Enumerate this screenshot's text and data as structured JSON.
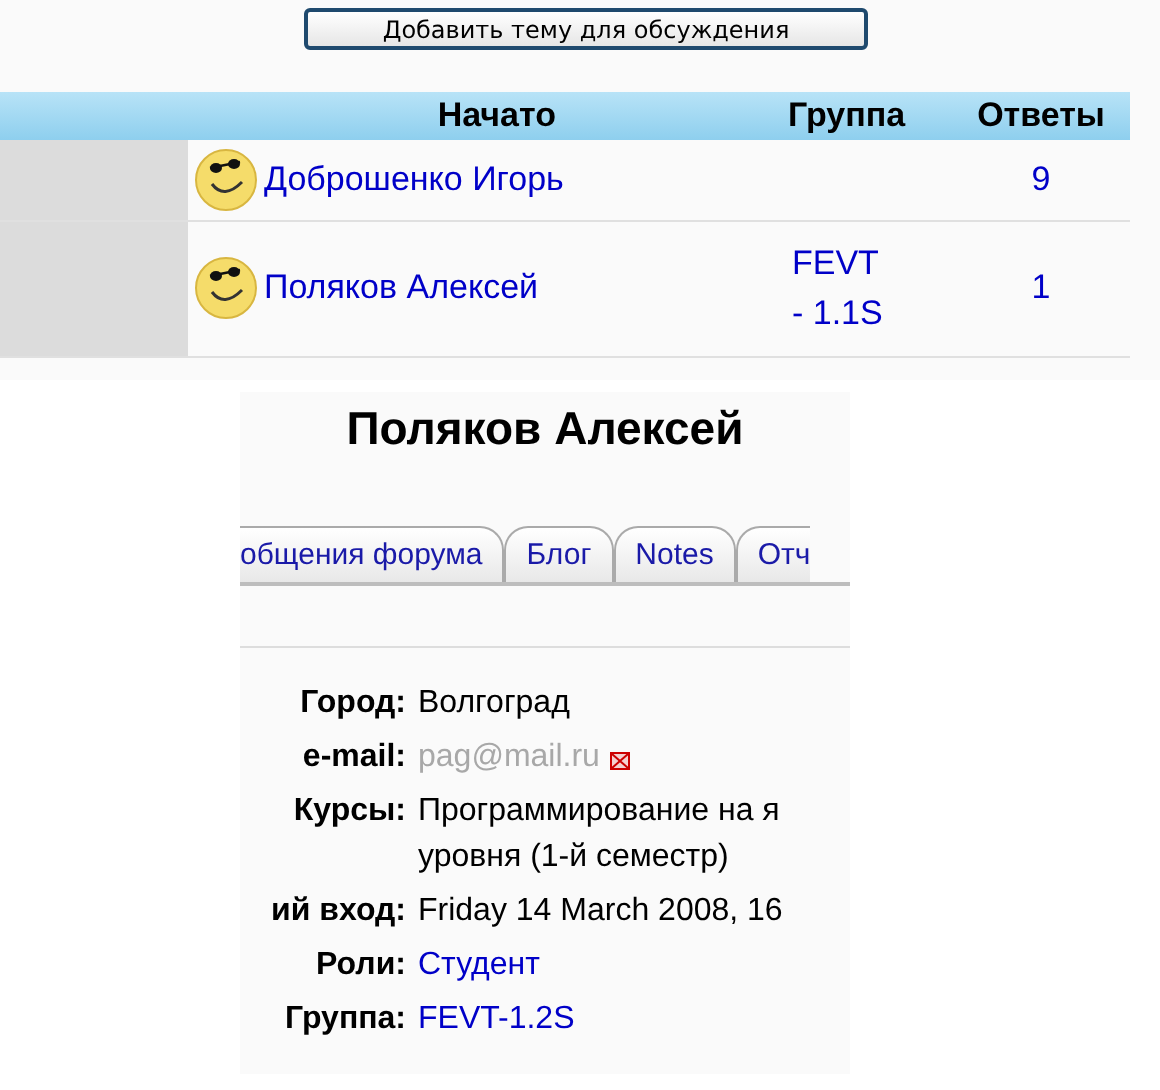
{
  "add_topic_button": "Добавить тему для обсуждения",
  "table": {
    "columns": [
      "Начато",
      "Группа",
      "Ответы"
    ],
    "rows": [
      {
        "started": "Доброшенко Игорь",
        "replies": "9"
      },
      {
        "started": "Поляков Алексей",
        "group": "FEVT - 1.1S",
        "replies": "1"
      }
    ]
  },
  "profile": {
    "name": "Поляков Алексей",
    "tabs": [
      {
        "label": "общения форума",
        "selected": false
      },
      {
        "label": "Блог",
        "selected": false
      },
      {
        "label": "Notes",
        "selected": false
      },
      {
        "label": "Отч",
        "selected": false
      }
    ],
    "fields": [
      {
        "label": "Город:",
        "kind": "text",
        "lines": [
          "Волгоград"
        ]
      },
      {
        "label": "e-mail:",
        "kind": "email",
        "lines": [
          "pag@mail.ru"
        ]
      },
      {
        "label": "Курсы:",
        "kind": "text",
        "lines": [
          "Программирование на я",
          "уровня (1-й семестр)"
        ]
      },
      {
        "label": "ий вход:",
        "kind": "text",
        "lines": [
          "Friday 14 March 2008, 16"
        ]
      },
      {
        "label": "Роли:",
        "kind": "link",
        "lines": [
          "Студент"
        ]
      },
      {
        "label": "Группа:",
        "kind": "link",
        "lines": [
          "FEVT-1.2S"
        ]
      }
    ]
  }
}
